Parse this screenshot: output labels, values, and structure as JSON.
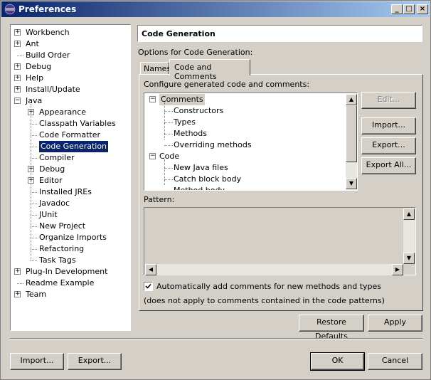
{
  "window": {
    "title": "Preferences"
  },
  "titlebar_buttons": {
    "minimize": "_",
    "maximize": "□",
    "close": "×"
  },
  "left_tree": {
    "items": [
      {
        "label": "Workbench",
        "expander": "+"
      },
      {
        "label": "Ant",
        "expander": "+"
      },
      {
        "label": "Build Order",
        "expander": ""
      },
      {
        "label": "Debug",
        "expander": "+"
      },
      {
        "label": "Help",
        "expander": "+"
      },
      {
        "label": "Install/Update",
        "expander": "+"
      },
      {
        "label": "Java",
        "expander": "−"
      },
      {
        "label": "Appearance",
        "expander": "+"
      },
      {
        "label": "Classpath Variables",
        "expander": ""
      },
      {
        "label": "Code Formatter",
        "expander": ""
      },
      {
        "label": "Code Generation",
        "expander": ""
      },
      {
        "label": "Compiler",
        "expander": ""
      },
      {
        "label": "Debug",
        "expander": "+"
      },
      {
        "label": "Editor",
        "expander": "+"
      },
      {
        "label": "Installed JREs",
        "expander": ""
      },
      {
        "label": "Javadoc",
        "expander": ""
      },
      {
        "label": "JUnit",
        "expander": ""
      },
      {
        "label": "New Project",
        "expander": ""
      },
      {
        "label": "Organize Imports",
        "expander": ""
      },
      {
        "label": "Refactoring",
        "expander": ""
      },
      {
        "label": "Task Tags",
        "expander": ""
      },
      {
        "label": "Plug-In Development",
        "expander": "+"
      },
      {
        "label": "Readme Example",
        "expander": ""
      },
      {
        "label": "Team",
        "expander": "+"
      }
    ]
  },
  "page": {
    "title": "Code Generation",
    "options_label": "Options for Code Generation:",
    "tabs": [
      {
        "label": "Names",
        "active": false
      },
      {
        "label": "Code and Comments",
        "active": true
      }
    ],
    "configure_label": "Configure generated code and comments:",
    "templates": [
      {
        "label": "Comments",
        "expander": "−"
      },
      {
        "label": "Constructors",
        "expander": ""
      },
      {
        "label": "Types",
        "expander": ""
      },
      {
        "label": "Methods",
        "expander": ""
      },
      {
        "label": "Overriding methods",
        "expander": ""
      },
      {
        "label": "Code",
        "expander": "−"
      },
      {
        "label": "New Java files",
        "expander": ""
      },
      {
        "label": "Catch block body",
        "expander": ""
      },
      {
        "label": "Method body",
        "expander": ""
      }
    ],
    "edit_button": "Edit...",
    "import_button": "Import...",
    "export_button": "Export...",
    "export_all_button": "Export All...",
    "pattern_label": "Pattern:",
    "pattern_value": "",
    "auto_comments_checkbox": {
      "label": "Automatically add comments for new methods and types",
      "checked": true
    },
    "note": "(does not apply to comments contained in the code patterns)",
    "restore_defaults_button": "Restore Defaults",
    "apply_button": "Apply"
  },
  "footer": {
    "import_button": "Import...",
    "export_button": "Export...",
    "ok_button": "OK",
    "cancel_button": "Cancel"
  },
  "colors": {
    "face": "#d4d0c8",
    "selection": "#0a246a",
    "title_start": "#0a246a",
    "title_end": "#a6caf0"
  }
}
